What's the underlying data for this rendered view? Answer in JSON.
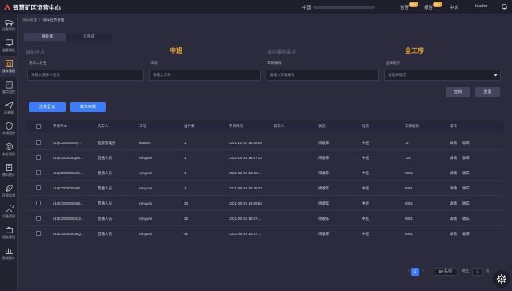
{
  "app": {
    "title": "智慧矿区运营中心"
  },
  "topbar": {
    "region": "中国",
    "alarm_label": "告警",
    "alarm_count": "99+",
    "notice_label": "报告",
    "notice_count": "99+",
    "language": "中文",
    "user": "leader"
  },
  "sidebar": {
    "items": [
      {
        "label": "运营管理",
        "icon": "truck-icon"
      },
      {
        "label": "监督看板",
        "icon": "monitor-icon"
      },
      {
        "label": "洗车管理",
        "icon": "wash-icon"
      },
      {
        "label": "重点监控",
        "icon": "building-icon"
      },
      {
        "label": "运单量",
        "icon": "plane-icon"
      },
      {
        "label": "车辆跟踪",
        "icon": "shield-icon"
      },
      {
        "label": "安全管理",
        "icon": "target-icon"
      },
      {
        "label": "物料统计",
        "icon": "doc-icon"
      },
      {
        "label": "环境监测",
        "icon": "leaf-icon"
      },
      {
        "label": "设备管理",
        "icon": "tools-icon"
      },
      {
        "label": "服务管理",
        "icon": "briefcase-icon"
      },
      {
        "label": "数据统计",
        "icon": "chart-icon"
      }
    ]
  },
  "breadcrumb": {
    "root": "洗车管理",
    "current": "洗车任务管理"
  },
  "tabs": [
    {
      "label": "待处理"
    },
    {
      "label": "已完成"
    }
  ],
  "stats": {
    "current_shift_label": "当前班次",
    "current_shift_value": "中班",
    "service_req_label": "当前服务要求",
    "service_req_value": "全工序"
  },
  "filters": {
    "washer_label": "洗车人姓名",
    "washer_placeholder": "请输入洗车人姓名",
    "employee_label": "工号",
    "employee_placeholder": "请输入工号",
    "vehicle_label": "车辆编号",
    "vehicle_placeholder": "请输入车辆编号",
    "shift_label": "选择班次",
    "shift_placeholder": "请选择班次"
  },
  "buttons": {
    "query": "查询",
    "reset": "重置",
    "wash_register": "洗车登记",
    "wash_receive": "收车审核"
  },
  "table": {
    "headers": [
      "申请单ID",
      "洗车人",
      "工号",
      "当件数",
      "申请时间",
      "取车人",
      "状态",
      "班次",
      "车牌编码",
      "操作"
    ],
    "rows": [
      {
        "id": "c1QC000000my...",
        "washer": "超级管理员",
        "emp": "leaders",
        "count": "1",
        "time": "2021-10-15 16:48:09",
        "picker": "",
        "status": "待收车",
        "shift": "中班",
        "plate": "11",
        "op1": "详情",
        "op2": "收车"
      },
      {
        "id": "c1QC000000qsS...",
        "washer": "普通人员",
        "emp": "renyuan",
        "count": "1",
        "time": "2021-10-13 16:07:13",
        "picker": "",
        "status": "待收车",
        "shift": "中班",
        "plate": "120",
        "op1": "详情",
        "op2": "收车"
      },
      {
        "id": "c1QC000000n6h...",
        "washer": "普通人员",
        "emp": "renyuan",
        "count": "1",
        "time": "2021-09-19 14:36:...",
        "picker": "",
        "status": "待收车",
        "shift": "中班",
        "plate": "0001",
        "op1": "详情",
        "op2": "收车"
      },
      {
        "id": "c1QC000000n8S...",
        "washer": "普通人员",
        "emp": "renyuan",
        "count": "1",
        "time": "2021-09-19 14:25:21",
        "picker": "",
        "status": "待收车",
        "shift": "中班",
        "plate": "0001",
        "op1": "详情",
        "op2": "收车"
      },
      {
        "id": "c1QC000000n8S...",
        "washer": "普通人员",
        "emp": "renyuan",
        "count": "23",
        "time": "2021-09-19 14:09:54",
        "picker": "",
        "status": "待收车",
        "shift": "中班",
        "plate": "0001",
        "op1": "详情",
        "op2": "收车"
      },
      {
        "id": "c1QC000000nQ2...",
        "washer": "普通人员",
        "emp": "renyuan",
        "count": "25",
        "time": "2021-09-19 10:07:...",
        "picker": "",
        "status": "待收车",
        "shift": "中班",
        "plate": "0001",
        "op1": "详情",
        "op2": "收车"
      },
      {
        "id": "c1QC000000n6Q...",
        "washer": "普通人员",
        "emp": "renyuan",
        "count": "25",
        "time": "2021-09-19 14:47:...",
        "picker": "",
        "status": "待收车",
        "shift": "中班",
        "plate": "0001",
        "op1": "详情",
        "op2": "收车"
      }
    ]
  },
  "pagination": {
    "prev": "‹",
    "page": "1",
    "next": "›",
    "page_size": "50 条/页",
    "goto_label": "跳至",
    "goto_value": "1",
    "page_suffix": "页"
  },
  "colors": {
    "accent": "#f5a623",
    "primary": "#3b7cff",
    "bg": "#2b2b3d"
  }
}
